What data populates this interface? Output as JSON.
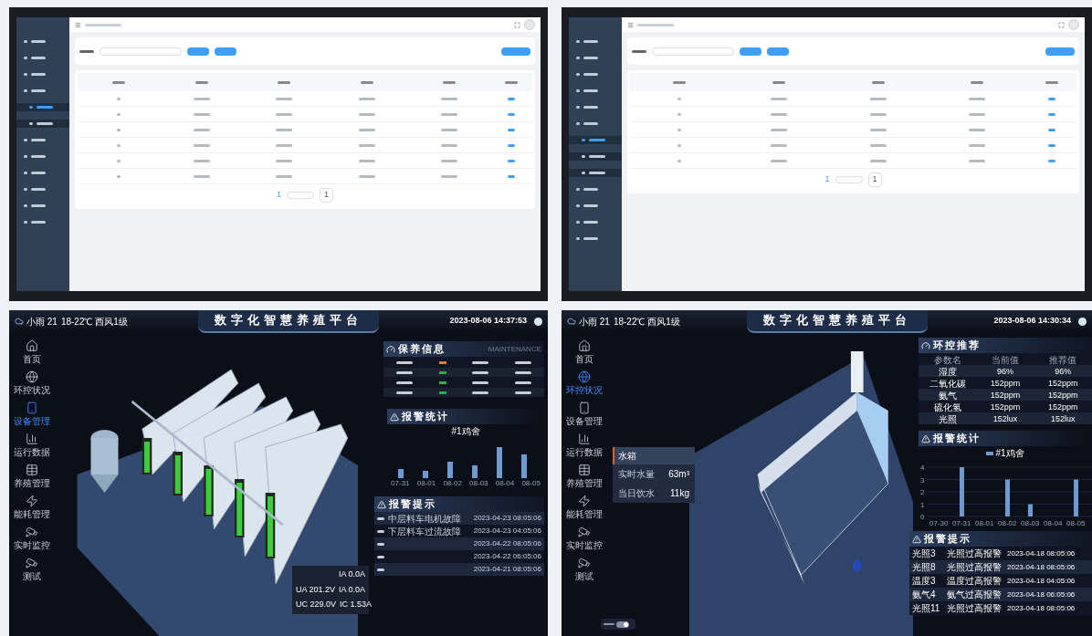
{
  "admin_screens": [
    {
      "pagination": {
        "current_page": "1",
        "goto_page": "1"
      }
    },
    {
      "pagination": {
        "current_page": "1",
        "goto_page": "1"
      }
    }
  ],
  "dashboards": [
    {
      "weather": "小雨 21",
      "weather_detail": "18-22℃ 西风1级",
      "title": "数字化智慧养殖平台",
      "datetime": "2023-08-06 14:37:53",
      "nav": [
        {
          "label": "首页",
          "selected": false
        },
        {
          "label": "环控状况",
          "selected": false
        },
        {
          "label": "设备管理",
          "selected": true
        },
        {
          "label": "运行数据",
          "selected": false
        },
        {
          "label": "养殖管理",
          "selected": false
        },
        {
          "label": "能耗管理",
          "selected": false
        },
        {
          "label": "实时监控",
          "selected": false
        },
        {
          "label": "测试",
          "selected": false
        }
      ],
      "maintenance": {
        "title": "保养信息",
        "subtitle": "MAINTENANCE",
        "statuses": [
          {
            "color": "#e07a2e"
          },
          {
            "color": "#22b14c"
          },
          {
            "color": "#22b14c"
          },
          {
            "color": "#22b14c"
          }
        ]
      },
      "alarm_stats": {
        "title": "报警统计",
        "legend": "#1鸡舍",
        "axis_labels": [
          "07-31",
          "08-01",
          "08-02",
          "08-03",
          "08-04",
          "08-05"
        ]
      },
      "alarm_list": {
        "title": "报警提示",
        "rows": [
          {
            "desc": "中层料车电机故障",
            "time": "2023-04-23 08:05:06"
          },
          {
            "desc": "下层料车过流故障",
            "time": "2023-04-23 04:05:06"
          },
          {
            "time": "2023-04-22 08:05:06"
          },
          {
            "time": "2023-04-22 06:05:06"
          },
          {
            "time": "2023-04-21 08:05:06"
          }
        ]
      },
      "power": {
        "top": "IA 0.0A",
        "rows": [
          [
            "UA 201.2V",
            "IA 0.0A"
          ],
          [
            "UC 229.0V",
            "IC 1.53A"
          ]
        ]
      }
    },
    {
      "weather": "小雨 21",
      "weather_detail": "18-22℃ 西风1级",
      "title": "数字化智慧养殖平台",
      "datetime": "2023-08-06 14:30:34",
      "nav": [
        {
          "label": "首页",
          "selected": false
        },
        {
          "label": "环控状况",
          "selected": true
        },
        {
          "label": "设备管理",
          "selected": false
        },
        {
          "label": "运行数据",
          "selected": false
        },
        {
          "label": "养殖管理",
          "selected": false
        },
        {
          "label": "能耗管理",
          "selected": false
        },
        {
          "label": "实时监控",
          "selected": false
        },
        {
          "label": "测试",
          "selected": false
        }
      ],
      "recommend": {
        "title": "环控推荐",
        "columns": [
          "参数名",
          "当前值",
          "推荐值"
        ],
        "rows": [
          [
            "湿度",
            "96%",
            "96%"
          ],
          [
            "二氧化碳",
            "152ppm",
            "152ppm"
          ],
          [
            "氨气",
            "152ppm",
            "152ppm"
          ],
          [
            "硫化氢",
            "152ppm",
            "152ppm"
          ],
          [
            "光照",
            "152lux",
            "152lux"
          ]
        ]
      },
      "alarm_stats": {
        "title": "报警统计",
        "chart_data": {
          "type": "bar",
          "categories": [
            "07-30",
            "07-31",
            "08-01",
            "08-02",
            "08-03",
            "08-04",
            "08-05"
          ],
          "series": [
            {
              "name": "#1鸡舍",
              "color": "#6d9bd1",
              "values": [
                0,
                4,
                0,
                3,
                1,
                0,
                3
              ]
            }
          ],
          "ylim": [
            0,
            4
          ],
          "yticks": [
            0,
            1,
            2,
            3,
            4
          ],
          "grid": true
        }
      },
      "alarm_list": {
        "title": "报警提示",
        "rows": [
          {
            "desc": "光照3",
            "text": "光照过高报警",
            "time": "2023-04-18 08:05:06"
          },
          {
            "desc": "光照8",
            "text": "光照过高报警",
            "time": "2023-04-18 08:05:06"
          },
          {
            "desc": "温度3",
            "text": "温度过高报警",
            "time": "2023-04-18 04:05:06"
          },
          {
            "desc": "氨气4",
            "text": "氨气过高报警",
            "time": "2023-04-18 06:05:06"
          },
          {
            "desc": "光照11",
            "text": "光照过高报警",
            "time": "2023-04-18 08:05:06"
          }
        ]
      },
      "tank": {
        "title": "水箱",
        "rows": [
          [
            "实时水量",
            "63m³"
          ],
          [
            "当日饮水",
            "11kg"
          ]
        ]
      },
      "toggle": {
        "on": true
      }
    }
  ]
}
